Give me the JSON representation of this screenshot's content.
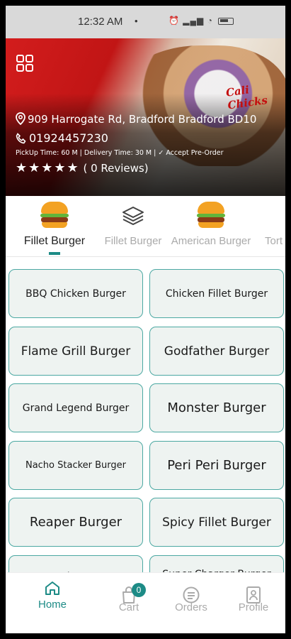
{
  "status_bar": {
    "time": "12:32 AM",
    "dot": "•"
  },
  "restaurant": {
    "brand": "Cali Chicks",
    "address": "909 Harrogate Rd, Bradford Bradford BD10",
    "phone": "01924457230",
    "times": "PickUp Time: 60 M | Delivery Time: 30 M | ✓ Accept Pre-Order",
    "stars": "★★★★★",
    "reviews": "( 0 Reviews)"
  },
  "categories": [
    {
      "label": "Fillet Burger",
      "icon": "burger-icon",
      "active": true
    },
    {
      "label": "Fillet Burger",
      "icon": "layers-icon",
      "active": false
    },
    {
      "label": "American Burger",
      "icon": "burger-icon",
      "active": false
    },
    {
      "label": "Tort",
      "icon": "",
      "active": false
    }
  ],
  "products": [
    "BBQ Chicken Burger",
    "Chicken Fillet Burger",
    "Flame Grill Burger",
    "Godfather Burger",
    "Grand Legend Burger",
    "Monster Burger",
    "Nacho Stacker Burger",
    "Peri Peri Burger",
    "Reaper Burger",
    "Spicy Fillet Burger",
    "Munch Burger",
    "Super Charger Burger"
  ],
  "bottom_nav": {
    "home": "Home",
    "cart": "Cart",
    "cart_count": "0",
    "orders": "Orders",
    "profile": "Profile"
  },
  "colors": {
    "accent": "#1d8b86",
    "hero_red": "#c11515",
    "card_border": "#4ba8a2"
  }
}
